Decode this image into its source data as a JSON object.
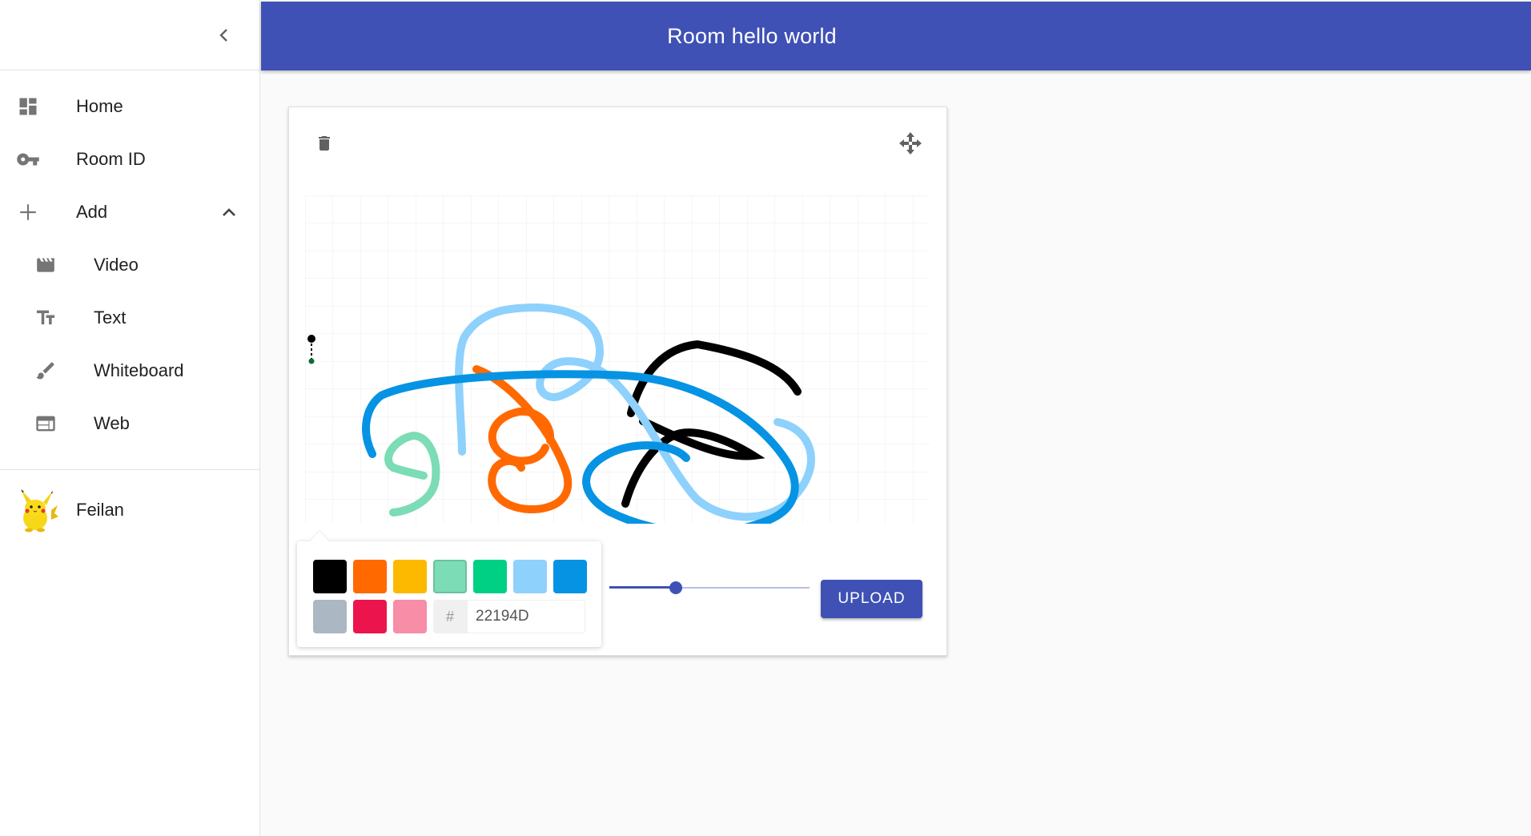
{
  "header": {
    "title": "Room hello world"
  },
  "sidebar": {
    "collapse_icon": "chevron-left-icon",
    "items": [
      {
        "label": "Home",
        "icon": "dashboard-icon"
      },
      {
        "label": "Room ID",
        "icon": "key-icon"
      },
      {
        "label": "Add",
        "icon": "plus-icon",
        "expanded": true
      }
    ],
    "add_subitems": [
      {
        "label": "Video",
        "icon": "movie-icon"
      },
      {
        "label": "Text",
        "icon": "text-fields-icon"
      },
      {
        "label": "Whiteboard",
        "icon": "brush-icon"
      },
      {
        "label": "Web",
        "icon": "web-icon"
      }
    ],
    "user": {
      "name": "Feilan",
      "avatar": "pikachu-avatar"
    }
  },
  "whiteboard": {
    "delete_icon": "trash-icon",
    "move_icon": "move-icon",
    "palette": [
      "#000000",
      "#FF6900",
      "#FCB900",
      "#7BDCB5",
      "#00D084",
      "#8ED1FC",
      "#0693E3",
      "#ABB8C3",
      "#EB144C",
      "#F78DA7"
    ],
    "hex_prefix": "#",
    "hex_value": "22194D",
    "brush_size": 0.33,
    "upload_label": "UPLOAD",
    "stroke_colors": {
      "black": "#000000",
      "orange": "#FF6900",
      "mint": "#7BDCB5",
      "light_blue": "#8ED1FC",
      "blue": "#0693E3"
    }
  },
  "colors": {
    "primary": "#3f51b5",
    "background": "#fafafa"
  }
}
